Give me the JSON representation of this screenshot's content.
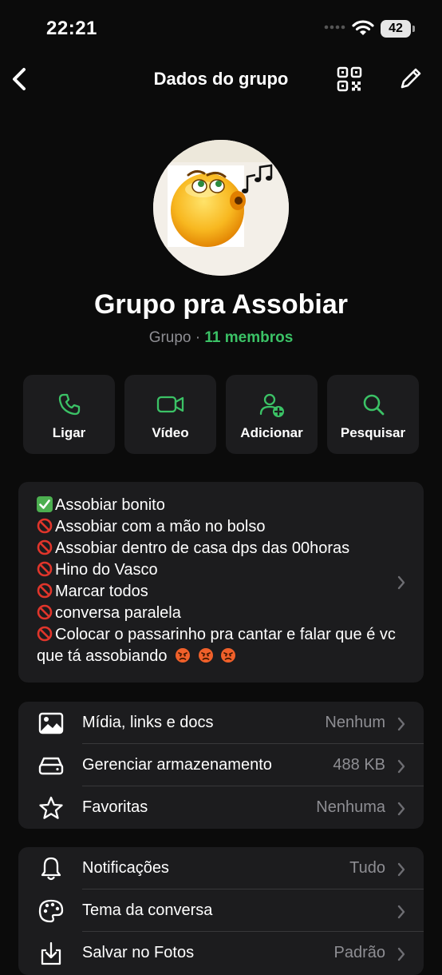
{
  "status_bar": {
    "time": "22:21",
    "battery": "42"
  },
  "nav": {
    "title": "Dados do grupo",
    "back_icon": "chevron-left-icon",
    "qr_icon": "qr-code-icon",
    "edit_icon": "pencil-icon"
  },
  "group": {
    "name": "Grupo pra Assobiar",
    "type": "Grupo",
    "separator": "·",
    "members": "11 membros"
  },
  "actions": [
    {
      "label": "Ligar",
      "icon": "phone-icon"
    },
    {
      "label": "Vídeo",
      "icon": "video-camera-icon"
    },
    {
      "label": "Adicionar",
      "icon": "add-person-icon"
    },
    {
      "label": "Pesquisar",
      "icon": "search-icon"
    }
  ],
  "description": [
    "Assobiar bonito",
    "Assobiar com a mão no bolso",
    "Assobiar dentro de casa dps das 00horas",
    "Hino do Vasco",
    "Marcar todos",
    "conversa paralela",
    "Colocar o passarinho pra cantar e falar que é vc que tá assobiando"
  ],
  "media_list": [
    {
      "label": "Mídia, links e docs",
      "value": "Nenhum",
      "icon": "image-icon"
    },
    {
      "label": "Gerenciar armazenamento",
      "value": "488 KB",
      "icon": "storage-drive-icon"
    },
    {
      "label": "Favoritas",
      "value": "Nenhuma",
      "icon": "star-icon"
    }
  ],
  "settings_list": [
    {
      "label": "Notificações",
      "value": "Tudo",
      "icon": "bell-icon"
    },
    {
      "label": "Tema da conversa",
      "value": "",
      "icon": "palette-icon"
    },
    {
      "label": "Salvar no Fotos",
      "value": "Padrão",
      "icon": "download-icon"
    }
  ],
  "colors": {
    "accent_green": "#3bc266",
    "card_bg": "#1c1c1e",
    "background": "#0b0b0b",
    "secondary_text": "#8e8e93"
  }
}
